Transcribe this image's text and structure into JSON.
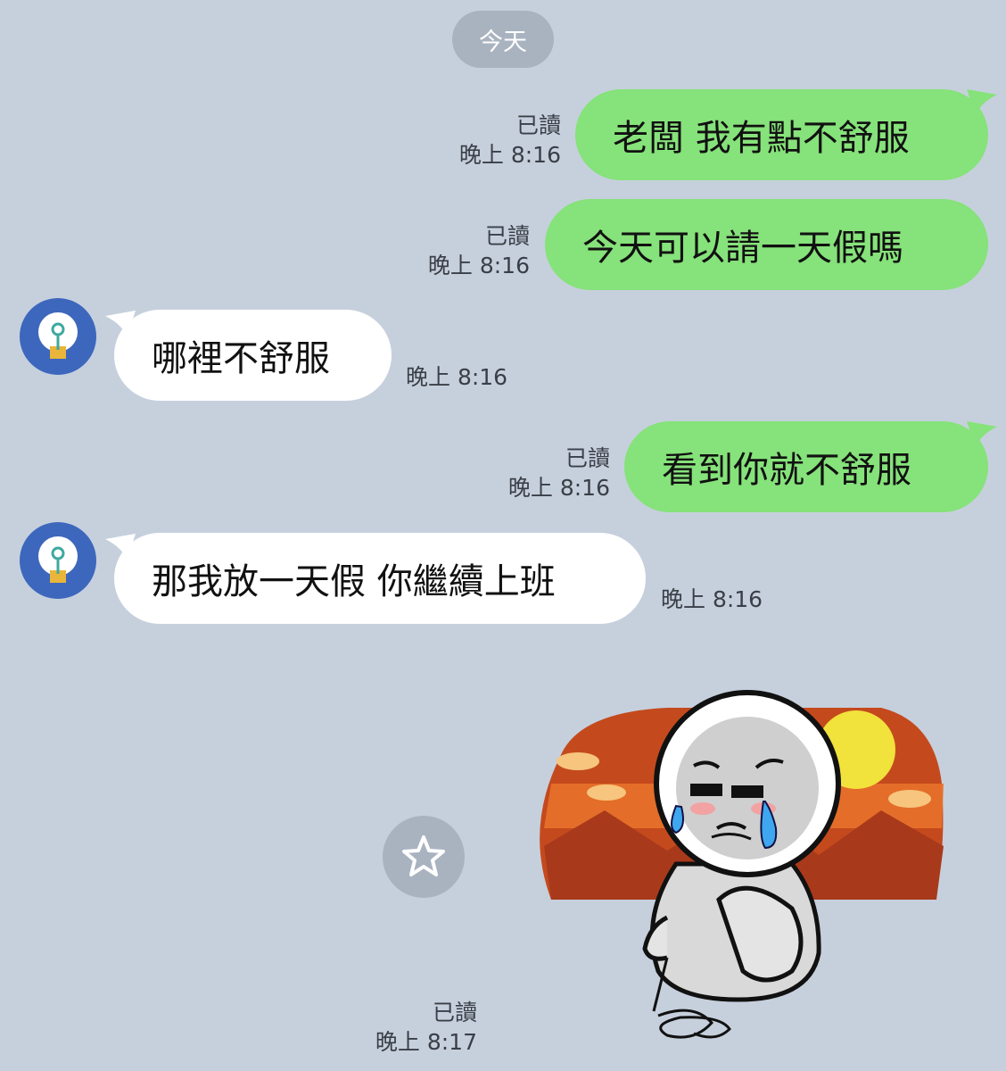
{
  "date_separator": "今天",
  "messages": [
    {
      "direction": "out",
      "text": "老闆 我有點不舒服",
      "read": "已讀",
      "time": "晚上 8:16"
    },
    {
      "direction": "out",
      "text": "今天可以請一天假嗎",
      "read": "已讀",
      "time": "晚上 8:16"
    },
    {
      "direction": "in",
      "text": "哪裡不舒服",
      "time": "晚上 8:16"
    },
    {
      "direction": "out",
      "text": "看到你就不舒服",
      "read": "已讀",
      "time": "晚上 8:16"
    },
    {
      "direction": "in",
      "text": "那我放一天假 你繼續上班",
      "time": "晚上 8:16"
    }
  ],
  "sticker_message": {
    "read": "已讀",
    "time": "晚上 8:17",
    "icon": "star-icon",
    "sticker": "crying-character-sticker"
  },
  "colors": {
    "background": "#c6d0dd",
    "outgoing_bubble": "#86e27a",
    "incoming_bubble": "#ffffff",
    "avatar": "#3d67bd"
  }
}
